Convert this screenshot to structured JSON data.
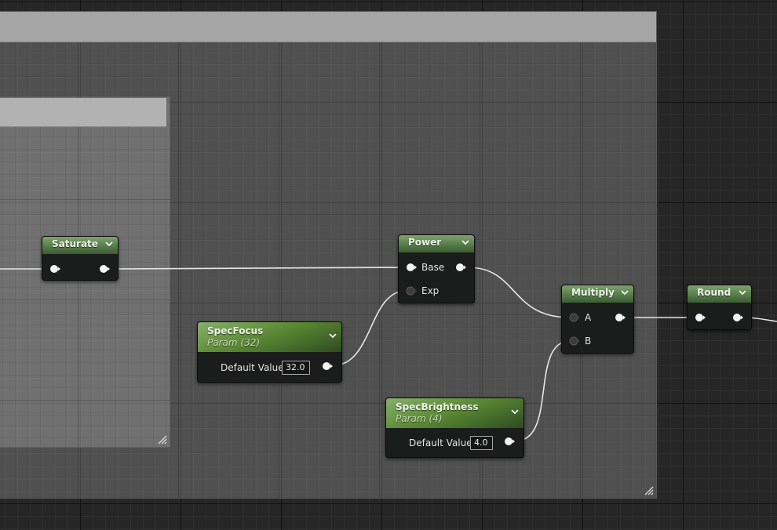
{
  "nodes": {
    "saturate": {
      "title": "Saturate"
    },
    "power": {
      "title": "Power",
      "pins": {
        "base": "Base",
        "exp": "Exp"
      }
    },
    "multiply": {
      "title": "Multiply",
      "pins": {
        "a": "A",
        "b": "B"
      }
    },
    "round": {
      "title": "Round"
    },
    "spec_focus": {
      "title": "SpecFocus",
      "subtitle": "Param (32)",
      "default_label": "Default Value",
      "default_value": "32.0"
    },
    "spec_brightness": {
      "title": "SpecBrightness",
      "subtitle": "Param (4)",
      "default_label": "Default Value",
      "default_value": "4.0"
    }
  },
  "icons": {
    "output_pin": "pin-output-icon",
    "input_pin": "pin-input-icon",
    "expand": "chevron-down-icon",
    "resize": "resize-grip-icon"
  },
  "colors": {
    "graph_background": "#262626",
    "node_header_green": "#5d8450",
    "node_body": "#1b1c1c",
    "wire": "#e6e6e6",
    "comment_title_bar": "#a5a5a5"
  }
}
